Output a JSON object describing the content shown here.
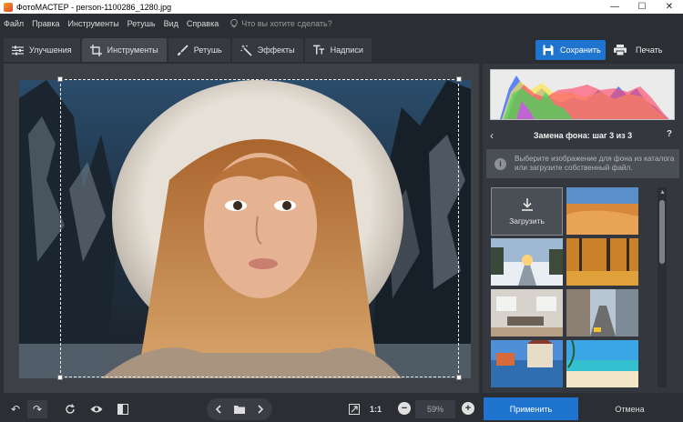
{
  "window": {
    "title": "ФотоМАСТЕР - person-1100286_1280.jpg",
    "minimize": "—",
    "maximize": "☐",
    "close": "✕"
  },
  "menu": {
    "items": [
      "Файл",
      "Правка",
      "Инструменты",
      "Ретушь",
      "Вид",
      "Справка"
    ],
    "search_placeholder": "Что вы хотите сделать?"
  },
  "tabs": [
    {
      "label": "Улучшения",
      "icon": "sliders-icon",
      "active": false
    },
    {
      "label": "Инструменты",
      "icon": "crop-icon",
      "active": true
    },
    {
      "label": "Ретушь",
      "icon": "brush-icon",
      "active": false
    },
    {
      "label": "Эффекты",
      "icon": "magic-wand-icon",
      "active": false
    },
    {
      "label": "Надписи",
      "icon": "text-icon",
      "active": false
    }
  ],
  "toolbar": {
    "save_label": "Сохранить",
    "print_label": "Печать"
  },
  "panel": {
    "step_title": "Замена фона: шаг 3 из 3",
    "back": "‹",
    "help": "?",
    "info_text": "Выберите изображение для фона из каталога или загрузите собственный файл.",
    "info_icon": "i",
    "upload_label": "Загрузить",
    "thumbnails": [
      "desert",
      "winter-road",
      "autumn-forest",
      "living-room",
      "city-street",
      "canal-town",
      "beach"
    ]
  },
  "bottom": {
    "undo": "↶",
    "redo": "↷",
    "zoom_fit_label": "1:1",
    "zoom_value": "59%",
    "zoom_out": "−",
    "zoom_in": "+",
    "apply_label": "Применить",
    "cancel_label": "Отмена"
  },
  "colors": {
    "accent": "#1f74d0",
    "background": "#2b2e33",
    "panel": "#34383e"
  }
}
